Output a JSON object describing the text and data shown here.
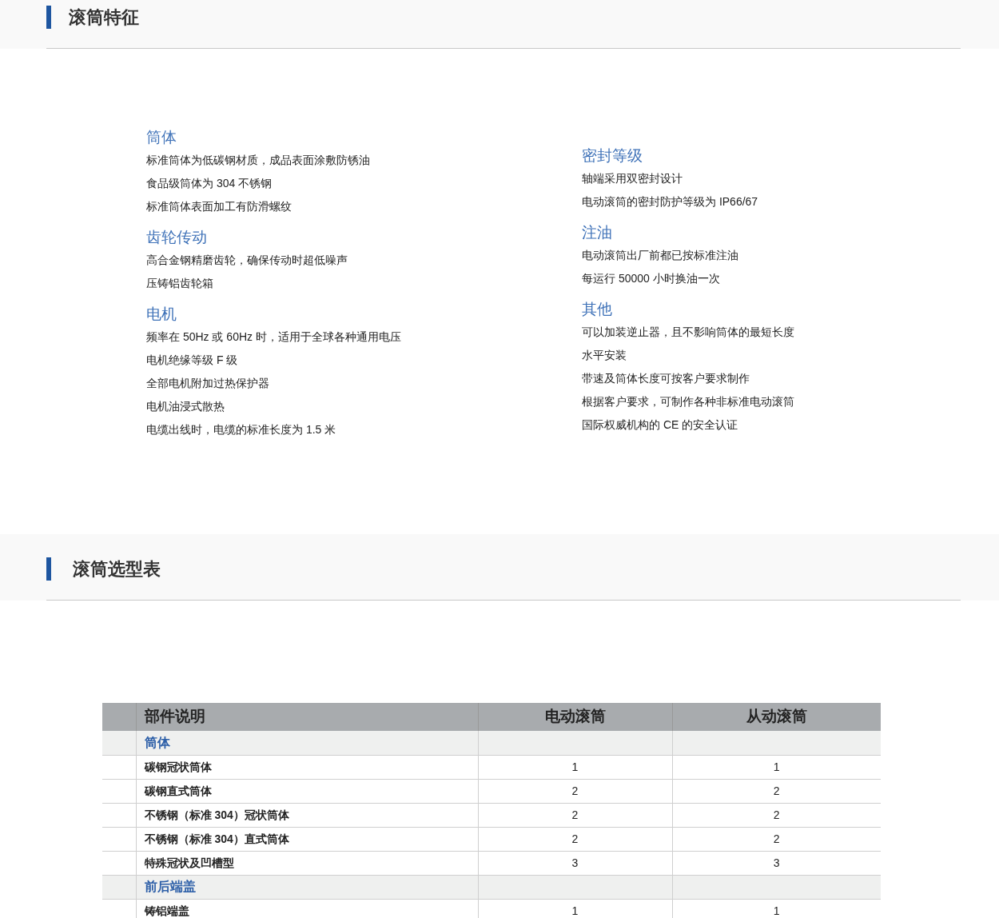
{
  "features_section": {
    "title": "滚筒特征",
    "left_groups": [
      {
        "heading": "筒体",
        "items": [
          "标准筒体为低碳钢材质，成品表面涂敷防锈油",
          "食品级筒体为 304 不锈钢",
          "标准筒体表面加工有防滑螺纹"
        ]
      },
      {
        "heading": "齿轮传动",
        "items": [
          "高合金钢精磨齿轮，确保传动时超低噪声",
          "压铸铝齿轮箱"
        ]
      },
      {
        "heading": "电机",
        "items": [
          "频率在 50Hz 或 60Hz 时，适用于全球各种通用电压",
          "电机绝缘等级 F 级",
          "全部电机附加过热保护器",
          "电机油浸式散热",
          "电缆出线时，电缆的标准长度为 1.5 米"
        ]
      }
    ],
    "right_groups": [
      {
        "heading": "密封等级",
        "items": [
          "轴端采用双密封设计",
          "电动滚筒的密封防护等级为 IP66/67"
        ]
      },
      {
        "heading": "注油",
        "items": [
          "电动滚筒出厂前都已按标准注油",
          "每运行 50000 小时换油一次"
        ]
      },
      {
        "heading": "其他",
        "items": [
          "可以加装逆止器，且不影响筒体的最短长度",
          "水平安装",
          "带速及筒体长度可按客户要求制作",
          "根据客户要求，可制作各种非标准电动滚筒",
          "国际权威机构的 CE 的安全认证"
        ]
      }
    ]
  },
  "selection_section": {
    "title": "滚筒选型表",
    "table": {
      "columns": [
        "部件说明",
        "电动滚筒",
        "从动滚筒"
      ],
      "rows": [
        {
          "kind": "group",
          "cells": [
            "筒体"
          ]
        },
        {
          "kind": "item",
          "cells": [
            "碳钢冠状筒体",
            "1",
            "1"
          ]
        },
        {
          "kind": "item",
          "cells": [
            "碳钢直式筒体",
            "2",
            "2"
          ]
        },
        {
          "kind": "item",
          "cells": [
            "不锈钢（标准 304）冠状筒体",
            "2",
            "2"
          ]
        },
        {
          "kind": "item",
          "cells": [
            "不锈钢（标准 304）直式筒体",
            "2",
            "2"
          ]
        },
        {
          "kind": "item",
          "cells": [
            "特殊冠状及凹槽型",
            "3",
            "3"
          ]
        },
        {
          "kind": "group",
          "cells": [
            "前后端盖"
          ]
        },
        {
          "kind": "item",
          "cells": [
            "铸铝端盖",
            "1",
            "1"
          ]
        }
      ]
    }
  }
}
